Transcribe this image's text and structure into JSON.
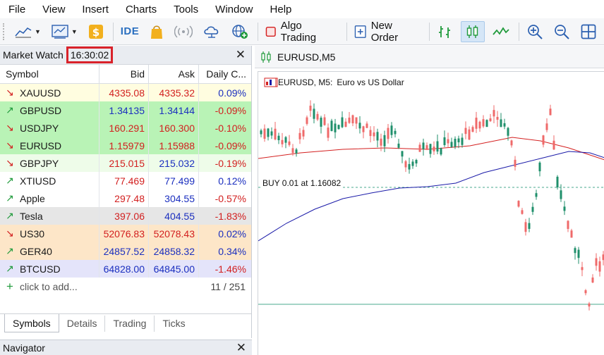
{
  "menu": [
    "File",
    "View",
    "Insert",
    "Charts",
    "Tools",
    "Window",
    "Help"
  ],
  "toolbar": {
    "ide_label": "IDE",
    "algo_trading_label": "Algo Trading",
    "new_order_label": "New Order"
  },
  "market_watch": {
    "title": "Market Watch",
    "time": "16:30:02",
    "columns": {
      "symbol": "Symbol",
      "bid": "Bid",
      "ask": "Ask",
      "change": "Daily C..."
    },
    "rows": [
      {
        "symbol": "XAUUSD",
        "bid": "4335.08",
        "ask": "4335.32",
        "change": "0.09%",
        "direction": "down",
        "bid_color": "red",
        "ask_color": "red",
        "change_color": "blue",
        "bg": "#fffde0"
      },
      {
        "symbol": "GBPUSD",
        "bid": "1.34135",
        "ask": "1.34144",
        "change": "-0.09%",
        "direction": "up",
        "bid_color": "blue",
        "ask_color": "blue",
        "change_color": "red",
        "bg": "#b9f3b6"
      },
      {
        "symbol": "USDJPY",
        "bid": "160.291",
        "ask": "160.300",
        "change": "-0.10%",
        "direction": "down",
        "bid_color": "red",
        "ask_color": "red",
        "change_color": "red",
        "bg": "#b9f3b6"
      },
      {
        "symbol": "EURUSD",
        "bid": "1.15979",
        "ask": "1.15988",
        "change": "-0.09%",
        "direction": "down",
        "bid_color": "red",
        "ask_color": "red",
        "change_color": "red",
        "bg": "#b9f3b6"
      },
      {
        "symbol": "GBPJPY",
        "bid": "215.015",
        "ask": "215.032",
        "change": "-0.19%",
        "direction": "down",
        "bid_color": "red",
        "ask_color": "blue",
        "change_color": "red",
        "bg": "#eefce9"
      },
      {
        "symbol": "XTIUSD",
        "bid": "77.469",
        "ask": "77.499",
        "change": "0.12%",
        "direction": "up",
        "bid_color": "red",
        "ask_color": "blue",
        "change_color": "blue",
        "bg": "#ffffff"
      },
      {
        "symbol": "Apple",
        "bid": "297.48",
        "ask": "304.55",
        "change": "-0.57%",
        "direction": "up",
        "bid_color": "red",
        "ask_color": "blue",
        "change_color": "red",
        "bg": "#ffffff"
      },
      {
        "symbol": "Tesla",
        "bid": "397.06",
        "ask": "404.55",
        "change": "-1.83%",
        "direction": "up",
        "bid_color": "red",
        "ask_color": "blue",
        "change_color": "red",
        "bg": "#e6e6e6"
      },
      {
        "symbol": "US30",
        "bid": "52076.83",
        "ask": "52078.43",
        "change": "0.02%",
        "direction": "down",
        "bid_color": "red",
        "ask_color": "red",
        "change_color": "blue",
        "bg": "#fde6c8"
      },
      {
        "symbol": "GER40",
        "bid": "24857.52",
        "ask": "24858.32",
        "change": "0.34%",
        "direction": "up",
        "bid_color": "blue",
        "ask_color": "blue",
        "change_color": "blue",
        "bg": "#fde6c8"
      },
      {
        "symbol": "BTCUSD",
        "bid": "64828.00",
        "ask": "64845.00",
        "change": "-1.46%",
        "direction": "up",
        "bid_color": "blue",
        "ask_color": "blue",
        "change_color": "red",
        "bg": "#e4e4fa"
      }
    ],
    "add_placeholder": "click to add...",
    "count": "11 / 251",
    "tabs": [
      "Symbols",
      "Details",
      "Trading",
      "Ticks"
    ]
  },
  "navigator": {
    "title": "Navigator"
  },
  "chart": {
    "tab_title": "EURUSD,M5",
    "symbol_period": "EURUSD, M5:",
    "description": "Euro vs US Dollar",
    "buy_label": "BUY 0.01 at 1.16082"
  },
  "colors": {
    "bull": "#1f8f6b",
    "bear": "#ef6a6a",
    "ma_fast": "#d42020",
    "ma_slow": "#1a1aa8",
    "price_up": "#1b2fbf",
    "price_down": "#d21f1f",
    "time_highlight": "#d9222a"
  }
}
